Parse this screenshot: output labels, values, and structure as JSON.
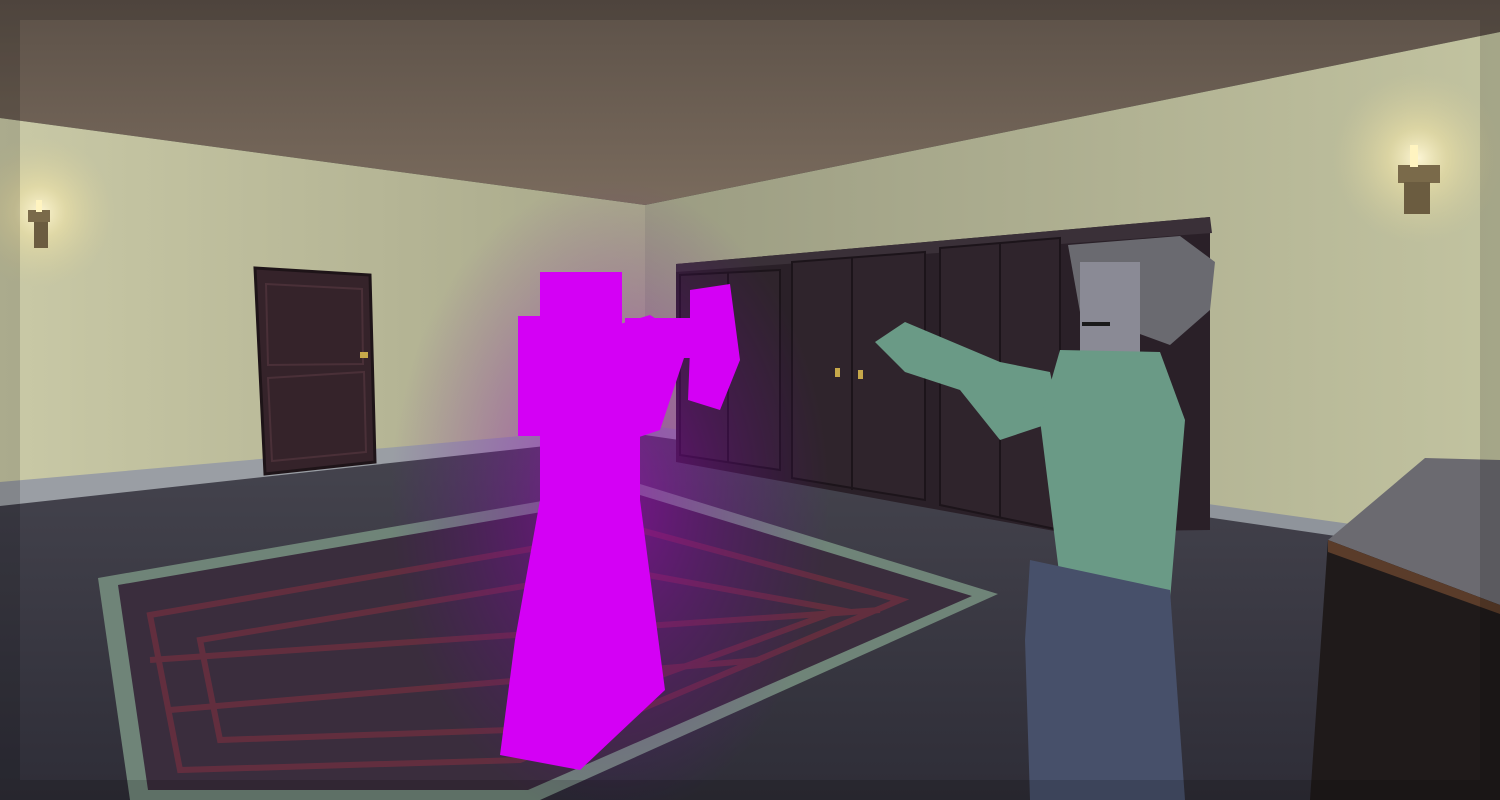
{
  "scene": {
    "type": "3d-voxel-game-viewport",
    "setting": "indoor-room",
    "hud": {}
  },
  "colors": {
    "ceiling": "#6b5f54",
    "wall": "#b9b996",
    "wall_shadow": "#8e8e74",
    "floor": "#3b3a46",
    "baseboard": "#9a9ea4",
    "rug_border": "#6f8478",
    "rug_inner": "#3a2d3d",
    "rug_pattern": "#6a2f3f",
    "door": "#35232a",
    "wardrobe": "#2a2028",
    "lamp_glow": "#fff6cc",
    "ghost": "#d400f5",
    "zombie_skin": "#6a9a86",
    "zombie_pants": "#47506a",
    "hair": "#6a6a70",
    "cabinet_top": "#6b6a70"
  },
  "objects": [
    {
      "name": "wall-lamp-left",
      "icon": "lamp-icon"
    },
    {
      "name": "wall-lamp-right",
      "icon": "lamp-icon"
    },
    {
      "name": "wooden-door"
    },
    {
      "name": "wardrobe-row",
      "count": 3
    },
    {
      "name": "patterned-rug"
    },
    {
      "name": "glowing-purple-ghost"
    },
    {
      "name": "green-zombie-character"
    },
    {
      "name": "cabinet-foreground"
    }
  ]
}
